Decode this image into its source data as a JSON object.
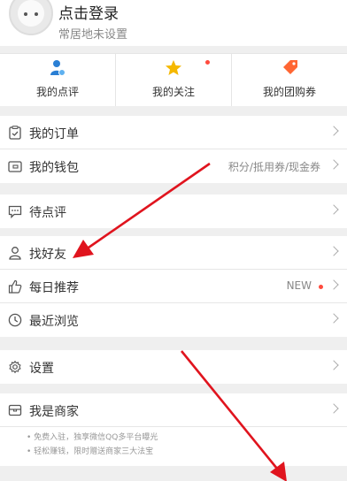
{
  "profile": {
    "login": "点击登录",
    "residence": "常居地未设置"
  },
  "quick": [
    {
      "label": "我的点评",
      "icon": "user-review-icon"
    },
    {
      "label": "我的关注",
      "icon": "star-icon"
    },
    {
      "label": "我的团购券",
      "icon": "coupon-tag-icon"
    }
  ],
  "menu": {
    "orders": "我的订单",
    "wallet": "我的钱包",
    "wallet_extra": "积分/抵用券/现金券",
    "pending_review": "待点评",
    "find_friends": "找好友",
    "daily_recommend": "每日推荐",
    "daily_extra": "NEW",
    "recent_browse": "最近浏览",
    "settings": "设置",
    "merchant": "我是商家"
  },
  "merchant_notes": [
    "• 免费入驻，独享微信QQ多平台曝光",
    "• 轻松赚钱，限时赠送商家三大法宝"
  ],
  "colors": {
    "accent": "#ff6633",
    "annotation_arrow": "#e0141e",
    "new_dot": "#ff4a3d"
  }
}
